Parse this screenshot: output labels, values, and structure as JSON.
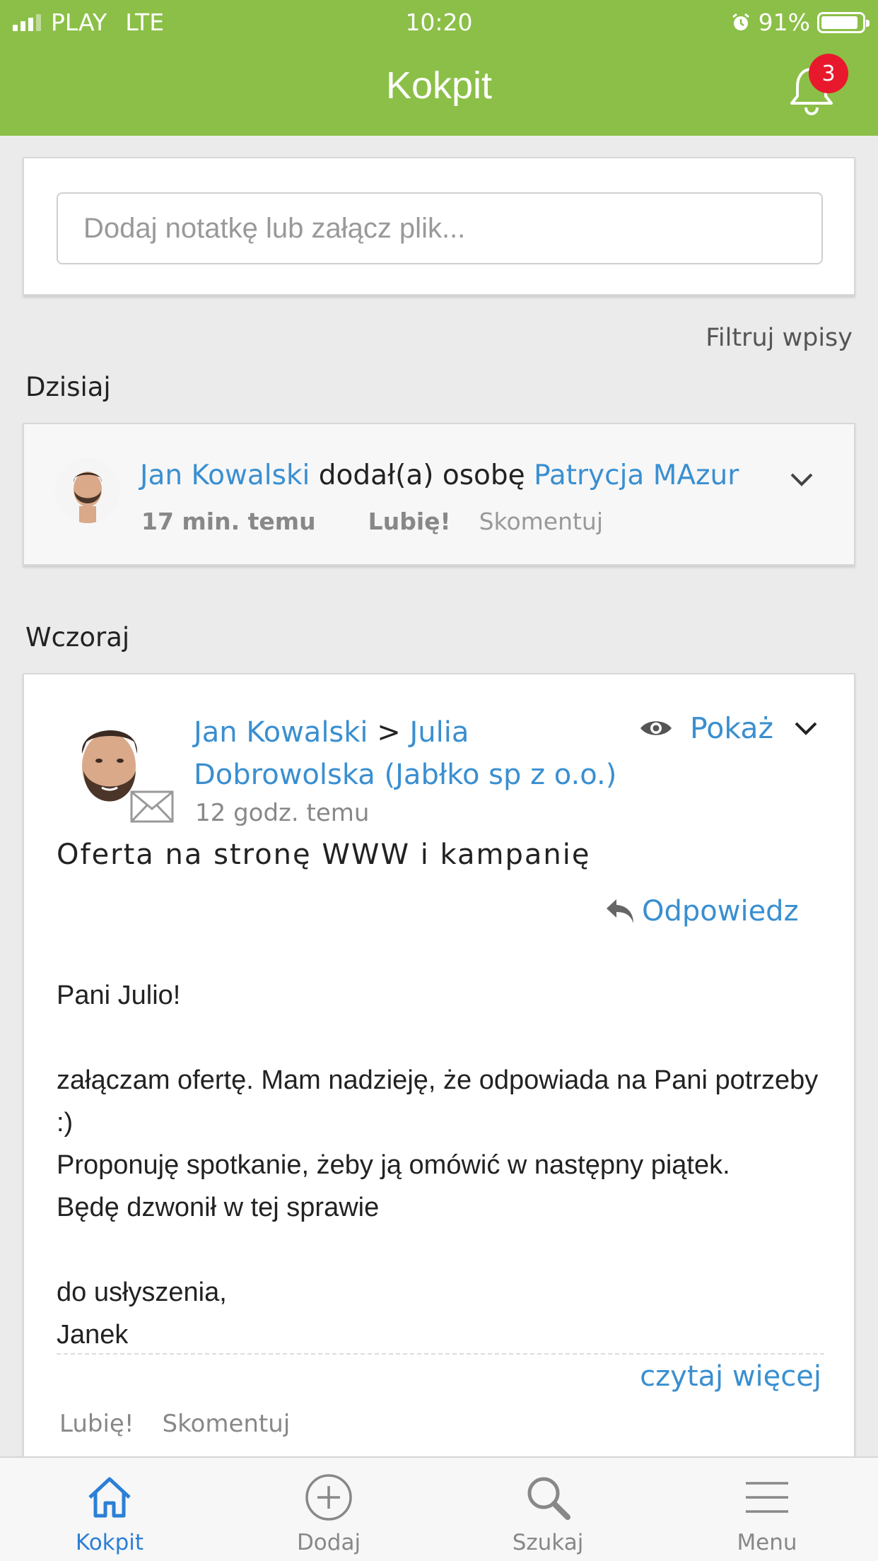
{
  "status_bar": {
    "carrier": "PLAY",
    "network": "LTE",
    "time": "10:20",
    "battery": "91%",
    "battery_level": 0.91
  },
  "header": {
    "title": "Kokpit",
    "notification_count": "3",
    "accent_color": "#8bbf47"
  },
  "note": {
    "placeholder": "Dodaj notatkę lub załącz plik..."
  },
  "filter_label": "Filtruj wpisy",
  "sections": {
    "today": "Dzisiaj",
    "yesterday": "Wczoraj"
  },
  "activity": {
    "author": "Jan Kowalski",
    "action": " dodał(a) osobę ",
    "target": "Patrycja MAzur",
    "time": "17 min. temu",
    "like": "Lubię!",
    "comment": "Skomentuj"
  },
  "email": {
    "author": "Jan Kowalski",
    "arrow": " > ",
    "recipient": "Julia Dobrowolska (Jabłko sp z o.o.)",
    "time": "12 godz. temu",
    "show_label": "Pokaż",
    "subject": "Oferta na stronę WWW i kampanię",
    "reply_label": "Odpowiedz",
    "body_lines": [
      "Pani Julio!",
      "",
      "załączam ofertę. Mam nadzieję, że odpowiada na Pani potrzeby :)",
      "Proponuję spotkanie, żeby ją omówić w następny piątek.",
      "Będę dzwonił w tej sprawie",
      "",
      "do usłyszenia,",
      "Janek"
    ],
    "read_more": "czytaj więcej",
    "like": "Lubię!",
    "comment": "Skomentuj"
  },
  "tabs": [
    {
      "label": "Kokpit",
      "icon": "home-icon",
      "active": true
    },
    {
      "label": "Dodaj",
      "icon": "plus-circle-icon",
      "active": false
    },
    {
      "label": "Szukaj",
      "icon": "search-icon",
      "active": false
    },
    {
      "label": "Menu",
      "icon": "menu-icon",
      "active": false
    }
  ],
  "colors": {
    "link": "#3a8fd0",
    "active_tab": "#2b7fd6",
    "badge": "#e8192c"
  }
}
